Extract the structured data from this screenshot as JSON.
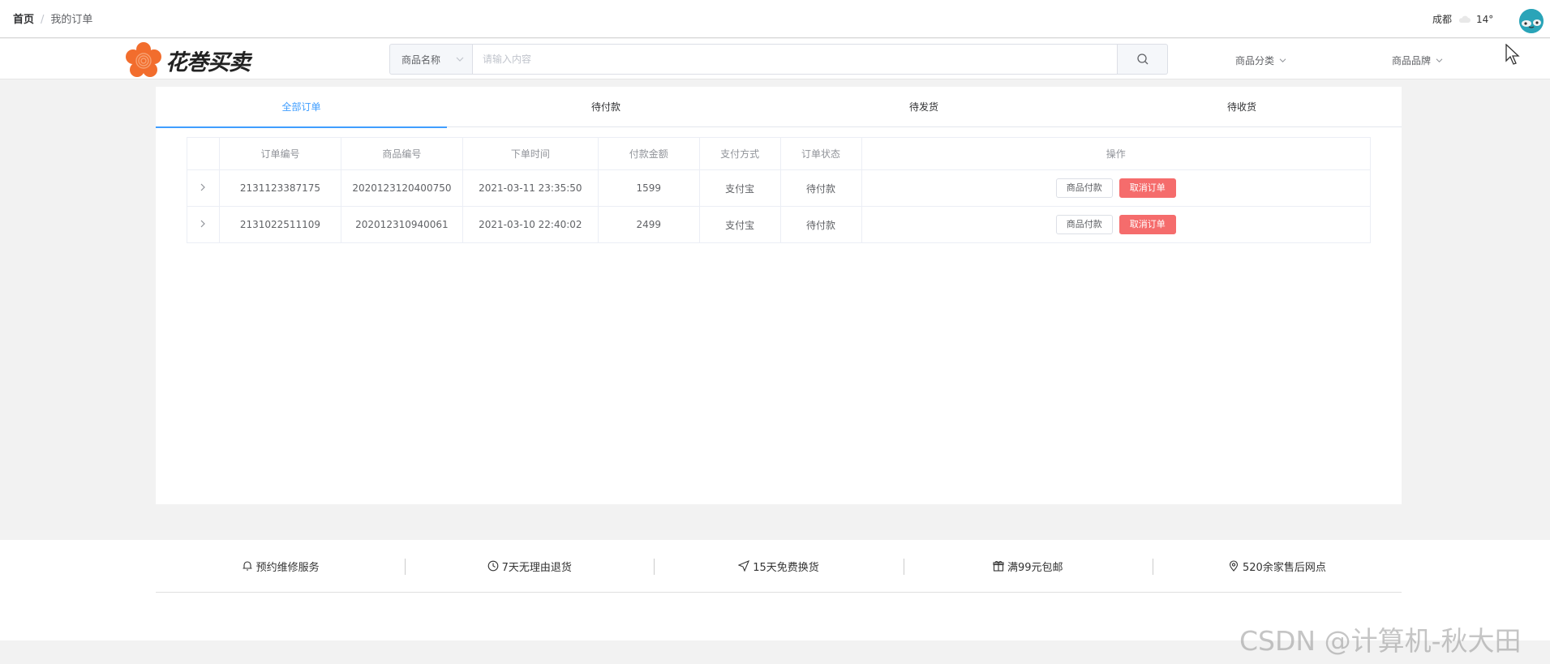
{
  "breadcrumb": {
    "home": "首页",
    "separator": "/",
    "current": "我的订单"
  },
  "weather": {
    "city": "成都",
    "temperature": "14°"
  },
  "logo": {
    "text": "花巻买卖",
    "color": "#f26d2d"
  },
  "search": {
    "category": "商品名称",
    "placeholder": "请输入内容",
    "value": ""
  },
  "menus": [
    {
      "label": "商品分类"
    },
    {
      "label": "商品品牌"
    }
  ],
  "tabs": [
    {
      "label": "全部订单",
      "active": true
    },
    {
      "label": "待付款"
    },
    {
      "label": "待发货"
    },
    {
      "label": "待收货"
    }
  ],
  "table": {
    "headers": [
      "订单编号",
      "商品编号",
      "下单时间",
      "付款金额",
      "支付方式",
      "订单状态",
      "操作"
    ],
    "rows": [
      {
        "order_no": "2131123387175",
        "product_no": "2020123120400750",
        "time": "2021-03-11 23:35:50",
        "amount": "1599",
        "pay": "支付宝",
        "status": "待付款"
      },
      {
        "order_no": "2131022511109",
        "product_no": "202012310940061",
        "time": "2021-03-10 22:40:02",
        "amount": "2499",
        "pay": "支付宝",
        "status": "待付款"
      }
    ],
    "actions": {
      "pay": "商品付款",
      "cancel": "取消订单"
    }
  },
  "services": [
    {
      "label": "预约维修服务",
      "icon": "bell-icon"
    },
    {
      "label": "7天无理由退货",
      "icon": "clock-icon"
    },
    {
      "label": "15天免费换货",
      "icon": "send-icon"
    },
    {
      "label": "满99元包邮",
      "icon": "gift-icon"
    },
    {
      "label": "520余家售后网点",
      "icon": "location-icon"
    }
  ],
  "watermark": "CSDN @计算机-秋大田",
  "colors": {
    "accent": "#409eff",
    "danger": "#f56c6c",
    "avatar": "#2aa4b8"
  }
}
